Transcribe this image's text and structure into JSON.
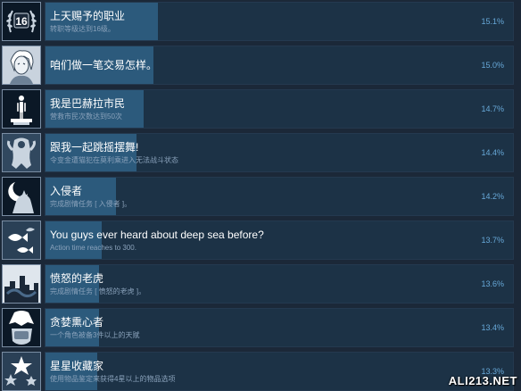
{
  "achievements": [
    {
      "name": "上天赐予的职业",
      "desc": "转职等级达到16级。",
      "percent": "15.1%",
      "fill": 0.24,
      "icon": "laurel-16-badge-icon"
    },
    {
      "name": "咱们做一笔交易怎样。",
      "desc": "",
      "percent": "15.0%",
      "fill": 0.23,
      "icon": "merchant-portrait-icon"
    },
    {
      "name": "我是巴赫拉市民",
      "desc": "营救市民次数达到50次",
      "percent": "14.7%",
      "fill": 0.21,
      "icon": "citizen-on-pedestal-icon"
    },
    {
      "name": "跟我一起跳摇摆舞!",
      "desc": "令变金遭猫犯在莫利乘进入无法战斗状态",
      "percent": "14.4%",
      "fill": 0.195,
      "icon": "dancing-figure-icon"
    },
    {
      "name": "入侵者",
      "desc": "完成剧情任务 [ 入侵者 ]。",
      "percent": "14.2%",
      "fill": 0.15,
      "icon": "moon-wolf-icon"
    },
    {
      "name": "You guys ever heard about deep sea before?",
      "desc": "Action time reaches to 300.",
      "percent": "13.7%",
      "fill": 0.12,
      "icon": "deep-sea-fish-icon"
    },
    {
      "name": "愤怒的老虎",
      "desc": "完成剧情任务 [ 愤怒的老虎 ]。",
      "percent": "13.6%",
      "fill": 0.115,
      "icon": "ruined-city-icon"
    },
    {
      "name": "贪婪熏心者",
      "desc": "一个角色被备3件以上的天赋",
      "percent": "13.4%",
      "fill": 0.115,
      "icon": "greedy-hand-icon"
    },
    {
      "name": "星星收藏家",
      "desc": "使用物品鉴定来获得4星以上的物品选项",
      "percent": "13.3%",
      "fill": 0.11,
      "icon": "star-collector-icon"
    }
  ],
  "watermark": "ALI213.NET",
  "colors": {
    "background": "#1b2838",
    "bar": "#1c3246",
    "bar_fill": "#2c5a7c",
    "percent_text": "#67a8d8",
    "desc_text": "#8aa2bb"
  }
}
